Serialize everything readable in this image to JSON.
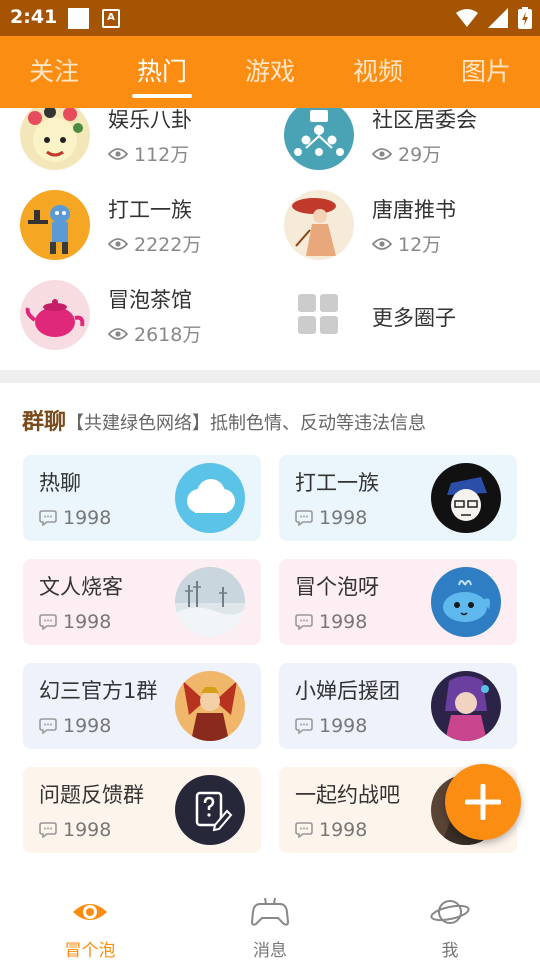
{
  "status_bar": {
    "time": "2:41",
    "notification_letter": "A"
  },
  "tabs": [
    {
      "label": "关注",
      "active": false
    },
    {
      "label": "热门",
      "active": true
    },
    {
      "label": "游戏",
      "active": false
    },
    {
      "label": "视频",
      "active": false
    },
    {
      "label": "图片",
      "active": false
    }
  ],
  "circles": [
    {
      "name": "娱乐八卦",
      "views": "112万"
    },
    {
      "name": "社区居委会",
      "views": "29万"
    },
    {
      "name": "打工一族",
      "views": "2222万"
    },
    {
      "name": "唐唐推书",
      "views": "12万"
    },
    {
      "name": "冒泡茶馆",
      "views": "2618万"
    },
    {
      "name": "更多圈子"
    }
  ],
  "group_chat": {
    "title": "群聊",
    "notice": "【共建绿色网络】抵制色情、反动等违法信息",
    "groups": [
      {
        "name": "热聊",
        "count": "1998",
        "bg": "#eaf6fb"
      },
      {
        "name": "打工一族",
        "count": "1998",
        "bg": "#eaf6fb"
      },
      {
        "name": "文人烧客",
        "count": "1998",
        "bg": "#fdeef3"
      },
      {
        "name": "冒个泡呀",
        "count": "1998",
        "bg": "#fdeef3"
      },
      {
        "name": "幻三官方1群",
        "count": "1998",
        "bg": "#eef3fb"
      },
      {
        "name": "小婵后援团",
        "count": "1998",
        "bg": "#eef3fb"
      },
      {
        "name": "问题反馈群",
        "count": "1998",
        "bg": "#fdf4ec"
      },
      {
        "name": "一起约战吧",
        "count": "1998",
        "bg": "#fdf4ec"
      }
    ]
  },
  "bottom_nav": [
    {
      "label": "冒个泡",
      "icon": "eye-icon",
      "active": true
    },
    {
      "label": "消息",
      "icon": "gamepad-icon",
      "active": false
    },
    {
      "label": "我",
      "icon": "planet-icon",
      "active": false
    }
  ],
  "colors": {
    "accent": "#fb8d12",
    "status_bar": "#a45402",
    "divider": "#efefef"
  }
}
